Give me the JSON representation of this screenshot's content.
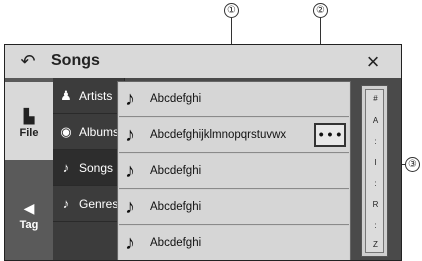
{
  "callouts": [
    "①",
    "②",
    "③"
  ],
  "header": {
    "back_icon": "back-arrow-icon",
    "title": "Songs",
    "close_label": "×"
  },
  "leftnav": [
    {
      "label": "File",
      "icon": "file-icon"
    },
    {
      "label": "Tag",
      "icon": "tag-icon"
    }
  ],
  "categories": [
    {
      "label": "Artists",
      "icon": "artist-icon"
    },
    {
      "label": "Albums",
      "icon": "album-icon"
    },
    {
      "label": "Songs",
      "icon": "music-note-icon"
    },
    {
      "label": "Genres",
      "icon": "genre-icon"
    }
  ],
  "songs": [
    "Abcdefghi",
    "Abcdefghijklmnopqrstuvwx",
    "Abcdefghi",
    "Abcdefghi",
    "Abcdefghi"
  ],
  "more_label": "• • •",
  "alphabet_index": [
    "#",
    "A",
    ":",
    "I",
    ":",
    "R",
    ":",
    "Z"
  ]
}
